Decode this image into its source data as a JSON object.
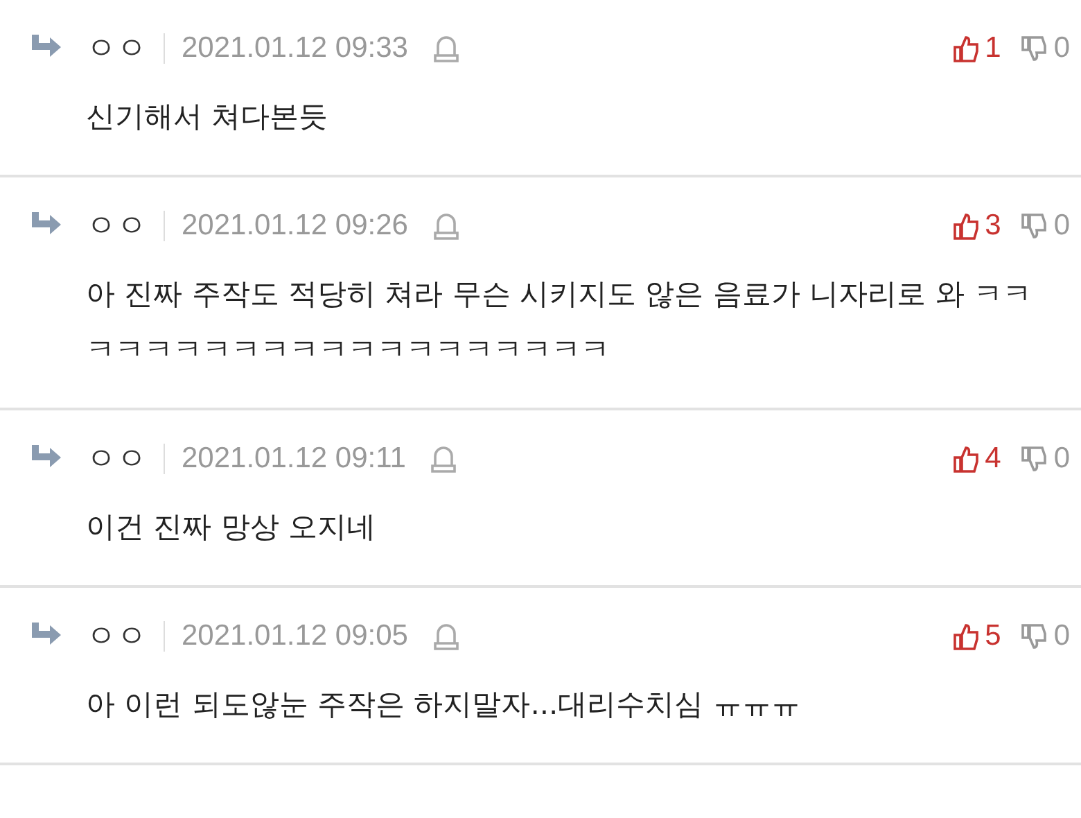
{
  "comments": [
    {
      "author": "ㅇㅇ",
      "date": "2021.01.12 09:33",
      "likes": "1",
      "dislikes": "0",
      "text": "신기해서 쳐다본듯"
    },
    {
      "author": "ㅇㅇ",
      "date": "2021.01.12 09:26",
      "likes": "3",
      "dislikes": "0",
      "text": "아 진짜 주작도 적당히 쳐라 무슨 시키지도 않은 음료가 니자리로 와 ㅋㅋㅋㅋㅋㅋㅋㅋㅋㅋㅋㅋㅋㅋㅋㅋㅋㅋㅋㅋ"
    },
    {
      "author": "ㅇㅇ",
      "date": "2021.01.12 09:11",
      "likes": "4",
      "dislikes": "0",
      "text": "이건 진짜 망상 오지네"
    },
    {
      "author": "ㅇㅇ",
      "date": "2021.01.12 09:05",
      "likes": "5",
      "dislikes": "0",
      "text": "아 이런 되도않눈 주작은 하지말자...대리수치심 ㅠㅠㅠ"
    }
  ]
}
